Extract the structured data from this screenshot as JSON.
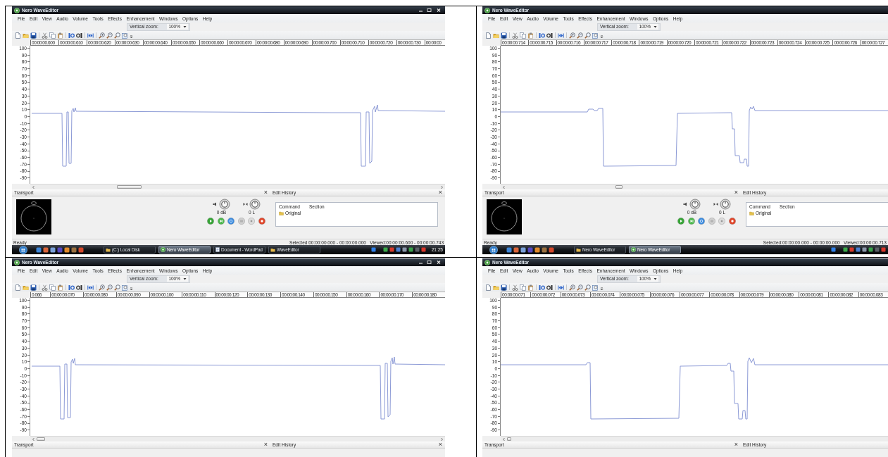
{
  "panels": [
    {
      "window": {
        "title": "Nero WaveEditor",
        "controls": [
          {
            "kind": "minimize"
          },
          {
            "kind": "maximize"
          },
          {
            "kind": "close"
          }
        ]
      },
      "menu": [
        "File",
        "Edit",
        "View",
        "Audio",
        "Volume",
        "Tools",
        "Effects",
        "Enhancement",
        "Windows",
        "Options",
        "Help"
      ],
      "vertical_zoom": {
        "label": "Vertical zoom:",
        "value": "100%"
      },
      "ruler": [
        "00:00:00.600",
        "00:00:00.610",
        "00:00:00.620",
        "00:00:00.630",
        "00:00:00.640",
        "00:00:00.650",
        "00:00:00.660",
        "00:00:00.670",
        "00:00:00.680",
        "00:00:00.690",
        "00:00:00.700",
        "00:00:00.710",
        "00:00:00.720",
        "00:00:00.730",
        "00:00:00"
      ],
      "y_axis": [
        "100",
        "90",
        "80",
        "70",
        "60",
        "50",
        "40",
        "30",
        "20",
        "10",
        "0",
        "-10",
        "-20",
        "-30",
        "-40",
        "-50",
        "-60",
        "-70",
        "-80",
        "-90"
      ],
      "transport": {
        "title": "Transport",
        "close": "×",
        "volume": "0 dB",
        "balance": "0 L"
      },
      "edit_history": {
        "title": "Edit History",
        "close": "×",
        "columns": [
          "Command",
          "Section"
        ],
        "rows": [
          "Original"
        ]
      },
      "status_bar": {
        "text": "Ready",
        "range": "Selected:00:00:00.000 - 00:00:00.000   Viewed:00:00:00.600 - 00:00:00.743"
      },
      "taskbar": {
        "tasks": [
          {
            "kind": "folder",
            "label": "(C:) Local Disk",
            "selected": false
          },
          {
            "kind": "app",
            "label": "Nero WaveEditor",
            "selected": true
          },
          {
            "kind": "document",
            "label": "Document - WordPad",
            "selected": false
          },
          {
            "kind": "folder",
            "label": "WaveEditor",
            "selected": false
          }
        ],
        "clock": "21:25"
      }
    },
    {
      "window": {
        "title": "Nero WaveEditor"
      },
      "menu": [
        "File",
        "Edit",
        "View",
        "Audio",
        "Volume",
        "Tools",
        "Effects",
        "Enhancement",
        "Windows",
        "Options",
        "Help"
      ],
      "vertical_zoom": {
        "label": "Vertical zoom:",
        "value": "100%"
      },
      "ruler": [
        "00:00:00.714",
        "00:00:00.715",
        "00:00:00.716",
        "00:00:00.717",
        "00:00:00.718",
        "00:00:00.719",
        "00:00:00.720",
        "00:00:00.721",
        "00:00:00.722",
        "00:00:00.723",
        "00:00:00.724",
        "00:00:00.725",
        "00:00:00.726",
        "00:00:00.727"
      ],
      "y_axis": [
        "100",
        "90",
        "80",
        "70",
        "60",
        "50",
        "40",
        "30",
        "20",
        "10",
        "0",
        "-10",
        "-20",
        "-30",
        "-40",
        "-50",
        "-60",
        "-70",
        "-80",
        "-90"
      ],
      "transport": {
        "title": "Transport",
        "close": "×",
        "volume": "0 dB",
        "balance": "0 L"
      },
      "edit_history": {
        "title": "Edit History",
        "columns": [
          "Command",
          "Section"
        ],
        "rows": [
          "Original"
        ]
      },
      "status_bar": {
        "text": "Ready",
        "range": "Selected:00:00:00.000 - 00:00:00.000   Viewed:00:00:00.713"
      },
      "taskbar": {
        "tasks": [
          {
            "kind": "folder",
            "label": "Nero WaveEditor",
            "selected": false
          },
          {
            "kind": "app",
            "label": "Nero WaveEditor",
            "selected": true
          }
        ]
      }
    },
    {
      "window": {
        "title": "Nero WaveEditor",
        "controls": [
          {
            "kind": "minimize"
          },
          {
            "kind": "maximize"
          },
          {
            "kind": "close"
          }
        ]
      },
      "menu": [
        "File",
        "Edit",
        "View",
        "Audio",
        "Volume",
        "Tools",
        "Effects",
        "Enhancement",
        "Windows",
        "Options",
        "Help"
      ],
      "vertical_zoom": {
        "label": "Vertical zoom:",
        "value": "100%"
      },
      "ruler": [
        "0.066",
        "00:00:00.070",
        "00:00:00.080",
        "00:00:00.090",
        "00:00:00.100",
        "00:00:00.110",
        "00:00:00.120",
        "00:00:00.130",
        "00:00:00.140",
        "00:00:00.150",
        "00:00:00.160",
        "00:00:00.170",
        "00:00:00.180"
      ],
      "y_axis": [
        "100",
        "90",
        "80",
        "70",
        "60",
        "50",
        "40",
        "30",
        "20",
        "10",
        "0",
        "-10",
        "-20",
        "-30",
        "-40",
        "-50",
        "-60",
        "-70",
        "-80",
        "-90"
      ],
      "transport": {
        "title": "Transport",
        "close": "×"
      },
      "edit_history": {
        "title": "Edit History",
        "close": "×"
      }
    },
    {
      "window": {
        "title": "Nero WaveEditor"
      },
      "menu": [
        "File",
        "Edit",
        "View",
        "Audio",
        "Volume",
        "Tools",
        "Effects",
        "Enhancement",
        "Windows",
        "Options",
        "Help"
      ],
      "vertical_zoom": {
        "label": "Vertical zoom:",
        "value": "100%"
      },
      "ruler": [
        "00:00:00.071",
        "00:00:00.072",
        "00:00:00.073",
        "00:00:00.074",
        "00:00:00.075",
        "00:00:00.076",
        "00:00:00.077",
        "00:00:00.078",
        "00:00:00.079",
        "00:00:00.080",
        "00:00:00.081",
        "00:00:00.082",
        "00:00:00.083"
      ],
      "y_axis": [
        "100",
        "90",
        "80",
        "70",
        "60",
        "50",
        "40",
        "30",
        "20",
        "10",
        "0",
        "-10",
        "-20",
        "-30",
        "-40",
        "-50",
        "-60",
        "-70",
        "-80",
        "-90"
      ],
      "transport": {
        "title": "Transport",
        "close": "×"
      },
      "edit_history": {
        "title": "Edit History"
      }
    }
  ]
}
